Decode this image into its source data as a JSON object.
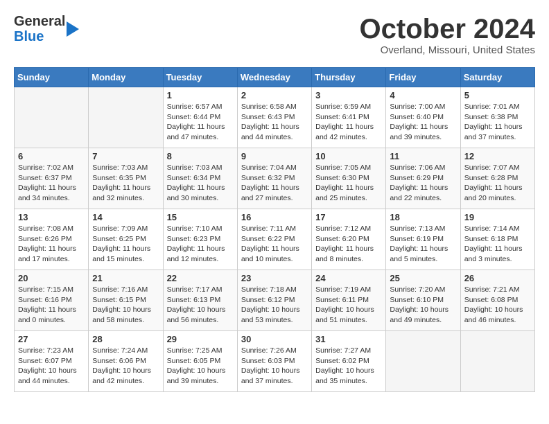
{
  "header": {
    "logo_line1": "General",
    "logo_line2": "Blue",
    "month": "October 2024",
    "location": "Overland, Missouri, United States"
  },
  "days_of_week": [
    "Sunday",
    "Monday",
    "Tuesday",
    "Wednesday",
    "Thursday",
    "Friday",
    "Saturday"
  ],
  "weeks": [
    [
      {
        "day": "",
        "info": ""
      },
      {
        "day": "",
        "info": ""
      },
      {
        "day": "1",
        "info": "Sunrise: 6:57 AM\nSunset: 6:44 PM\nDaylight: 11 hours and 47 minutes."
      },
      {
        "day": "2",
        "info": "Sunrise: 6:58 AM\nSunset: 6:43 PM\nDaylight: 11 hours and 44 minutes."
      },
      {
        "day": "3",
        "info": "Sunrise: 6:59 AM\nSunset: 6:41 PM\nDaylight: 11 hours and 42 minutes."
      },
      {
        "day": "4",
        "info": "Sunrise: 7:00 AM\nSunset: 6:40 PM\nDaylight: 11 hours and 39 minutes."
      },
      {
        "day": "5",
        "info": "Sunrise: 7:01 AM\nSunset: 6:38 PM\nDaylight: 11 hours and 37 minutes."
      }
    ],
    [
      {
        "day": "6",
        "info": "Sunrise: 7:02 AM\nSunset: 6:37 PM\nDaylight: 11 hours and 34 minutes."
      },
      {
        "day": "7",
        "info": "Sunrise: 7:03 AM\nSunset: 6:35 PM\nDaylight: 11 hours and 32 minutes."
      },
      {
        "day": "8",
        "info": "Sunrise: 7:03 AM\nSunset: 6:34 PM\nDaylight: 11 hours and 30 minutes."
      },
      {
        "day": "9",
        "info": "Sunrise: 7:04 AM\nSunset: 6:32 PM\nDaylight: 11 hours and 27 minutes."
      },
      {
        "day": "10",
        "info": "Sunrise: 7:05 AM\nSunset: 6:30 PM\nDaylight: 11 hours and 25 minutes."
      },
      {
        "day": "11",
        "info": "Sunrise: 7:06 AM\nSunset: 6:29 PM\nDaylight: 11 hours and 22 minutes."
      },
      {
        "day": "12",
        "info": "Sunrise: 7:07 AM\nSunset: 6:28 PM\nDaylight: 11 hours and 20 minutes."
      }
    ],
    [
      {
        "day": "13",
        "info": "Sunrise: 7:08 AM\nSunset: 6:26 PM\nDaylight: 11 hours and 17 minutes."
      },
      {
        "day": "14",
        "info": "Sunrise: 7:09 AM\nSunset: 6:25 PM\nDaylight: 11 hours and 15 minutes."
      },
      {
        "day": "15",
        "info": "Sunrise: 7:10 AM\nSunset: 6:23 PM\nDaylight: 11 hours and 12 minutes."
      },
      {
        "day": "16",
        "info": "Sunrise: 7:11 AM\nSunset: 6:22 PM\nDaylight: 11 hours and 10 minutes."
      },
      {
        "day": "17",
        "info": "Sunrise: 7:12 AM\nSunset: 6:20 PM\nDaylight: 11 hours and 8 minutes."
      },
      {
        "day": "18",
        "info": "Sunrise: 7:13 AM\nSunset: 6:19 PM\nDaylight: 11 hours and 5 minutes."
      },
      {
        "day": "19",
        "info": "Sunrise: 7:14 AM\nSunset: 6:18 PM\nDaylight: 11 hours and 3 minutes."
      }
    ],
    [
      {
        "day": "20",
        "info": "Sunrise: 7:15 AM\nSunset: 6:16 PM\nDaylight: 11 hours and 0 minutes."
      },
      {
        "day": "21",
        "info": "Sunrise: 7:16 AM\nSunset: 6:15 PM\nDaylight: 10 hours and 58 minutes."
      },
      {
        "day": "22",
        "info": "Sunrise: 7:17 AM\nSunset: 6:13 PM\nDaylight: 10 hours and 56 minutes."
      },
      {
        "day": "23",
        "info": "Sunrise: 7:18 AM\nSunset: 6:12 PM\nDaylight: 10 hours and 53 minutes."
      },
      {
        "day": "24",
        "info": "Sunrise: 7:19 AM\nSunset: 6:11 PM\nDaylight: 10 hours and 51 minutes."
      },
      {
        "day": "25",
        "info": "Sunrise: 7:20 AM\nSunset: 6:10 PM\nDaylight: 10 hours and 49 minutes."
      },
      {
        "day": "26",
        "info": "Sunrise: 7:21 AM\nSunset: 6:08 PM\nDaylight: 10 hours and 46 minutes."
      }
    ],
    [
      {
        "day": "27",
        "info": "Sunrise: 7:23 AM\nSunset: 6:07 PM\nDaylight: 10 hours and 44 minutes."
      },
      {
        "day": "28",
        "info": "Sunrise: 7:24 AM\nSunset: 6:06 PM\nDaylight: 10 hours and 42 minutes."
      },
      {
        "day": "29",
        "info": "Sunrise: 7:25 AM\nSunset: 6:05 PM\nDaylight: 10 hours and 39 minutes."
      },
      {
        "day": "30",
        "info": "Sunrise: 7:26 AM\nSunset: 6:03 PM\nDaylight: 10 hours and 37 minutes."
      },
      {
        "day": "31",
        "info": "Sunrise: 7:27 AM\nSunset: 6:02 PM\nDaylight: 10 hours and 35 minutes."
      },
      {
        "day": "",
        "info": ""
      },
      {
        "day": "",
        "info": ""
      }
    ]
  ]
}
